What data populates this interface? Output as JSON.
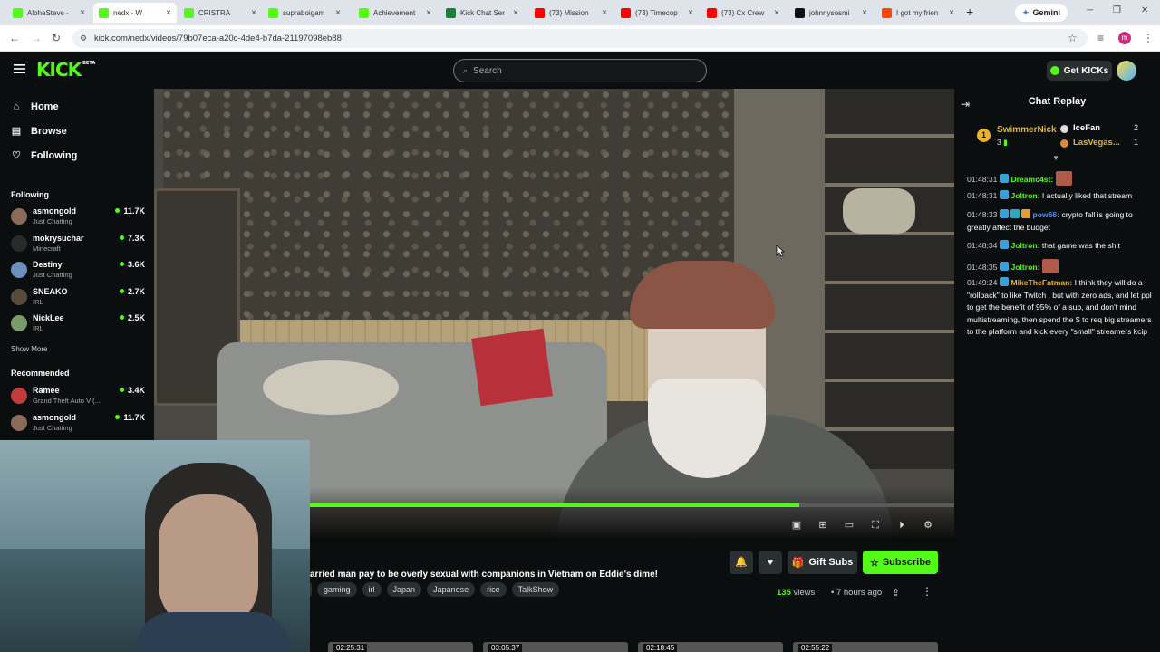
{
  "browser": {
    "tabs": [
      {
        "label": "AlohaSteve - ",
        "icon_color": "#53fc18",
        "active": false
      },
      {
        "label": "nedx - W",
        "icon_color": "#53fc18",
        "active": true
      },
      {
        "label": "CRISTRA",
        "icon_color": "#53fc18",
        "active": false
      },
      {
        "label": "supraboigam",
        "icon_color": "#53fc18",
        "active": false
      },
      {
        "label": "Achievement",
        "icon_color": "#53fc18",
        "active": false
      },
      {
        "label": "Kick Chat Ser",
        "icon_color": "#1b7f3a",
        "active": false
      },
      {
        "label": "(73) Mission",
        "icon_color": "#ff0000",
        "active": false
      },
      {
        "label": "(73) Timecop",
        "icon_color": "#ff0000",
        "active": false
      },
      {
        "label": "(73) Cx Crew",
        "icon_color": "#ff0000",
        "active": false
      },
      {
        "label": "johnnysosmi",
        "icon_color": "#111111",
        "active": false
      },
      {
        "label": "I got my frien",
        "icon_color": "#ff4500",
        "active": false
      }
    ],
    "new_tab": "+",
    "gemini_label": "Gemini",
    "url": "kick.com/nedx/videos/79b07eca-a20c-4de4-b7da-21197098eb88"
  },
  "header": {
    "logo": "KICK",
    "logo_badge": "BETA",
    "search_placeholder": "Search",
    "get_kicks": "Get KICKs"
  },
  "sidebar": {
    "nav": [
      {
        "label": "Home",
        "icon": "home-icon"
      },
      {
        "label": "Browse",
        "icon": "browse-icon"
      },
      {
        "label": "Following",
        "icon": "heart-icon"
      }
    ],
    "following_heading": "Following",
    "following": [
      {
        "name": "asmongold",
        "category": "Just Chatting",
        "viewers": "11.7K",
        "color": "#8a6b5a"
      },
      {
        "name": "mokrysuchar",
        "category": "Minecraft",
        "viewers": "7.3K",
        "color": "#2a2a2a"
      },
      {
        "name": "Destiny",
        "category": "Just Chatting",
        "viewers": "3.6K",
        "color": "#6b8fbf"
      },
      {
        "name": "SNEAKO",
        "category": "IRL",
        "viewers": "2.7K",
        "color": "#5a4a3a"
      },
      {
        "name": "NickLee",
        "category": "IRL",
        "viewers": "2.5K",
        "color": "#7a9a6a"
      }
    ],
    "show_more": "Show More",
    "recommended_heading": "Recommended",
    "recommended": [
      {
        "name": "Ramee",
        "category": "Grand Theft Auto V (...",
        "viewers": "3.4K",
        "color": "#c23b3b"
      },
      {
        "name": "asmongold",
        "category": "Just Chatting",
        "viewers": "11.7K",
        "color": "#8a6b5a"
      }
    ]
  },
  "video": {
    "progress_percent": 76,
    "title_fragment": "arried man pay to be overly sexual with companions in Vietnam on Eddie's dime!",
    "tags": [
      "gaming",
      "irl",
      "Japan",
      "Japanese",
      "rice",
      "TalkShow"
    ],
    "gift_subs": "Gift Subs",
    "subscribe": "Subscribe",
    "views_count": "135",
    "views_label": "views",
    "posted": "7 hours ago",
    "thumbnails": [
      "02:25:31",
      "03:05:37",
      "02:18:45",
      "02:55:22"
    ]
  },
  "chat": {
    "title": "Chat Replay",
    "leaderboard": [
      {
        "rank": "1",
        "name": "SwimmerNick",
        "value": "3"
      },
      {
        "name": "IceFan",
        "value": "2"
      },
      {
        "name": "LasVegas...",
        "value": "1"
      }
    ],
    "messages": [
      {
        "time": "01:48:31",
        "user": "Dreamc4st:",
        "text": "",
        "color": "#53fc18"
      },
      {
        "time": "01:48:31",
        "user": "Joltron:",
        "text": "I actually liked that stream",
        "color": "#53fc18"
      },
      {
        "time": "01:48:33",
        "user": "pow66:",
        "text": "crypto fall is going to greatly affect the budget",
        "color": "#5b8cff"
      },
      {
        "time": "01:48:34",
        "user": "Joltron:",
        "text": "that game was the shit",
        "color": "#53fc18"
      },
      {
        "time": "01:48:35",
        "user": "Joltron:",
        "text": "",
        "color": "#53fc18"
      },
      {
        "time": "01:49:24",
        "user": "MikeTheFatman:",
        "text": "I think they will do a \"rollback\" to like Twitch , but with zero ads, and let ppl to get the benefit of 95% of a sub, and don't mind multistreaming, then spend the $ to req big streamers to the platform and kick every \"small\" streamers kcip",
        "color": "#e7b42b"
      }
    ]
  }
}
